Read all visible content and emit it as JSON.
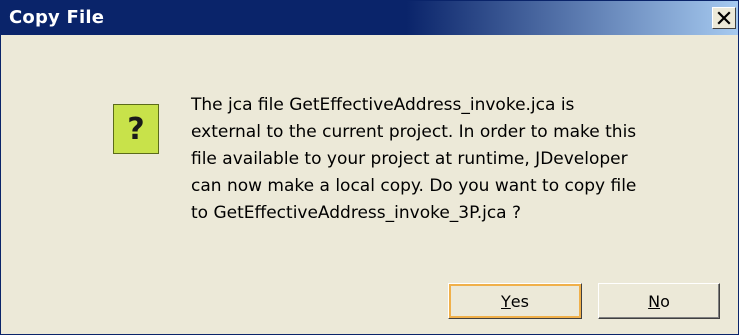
{
  "window": {
    "title": "Copy File",
    "close_icon": "close-icon"
  },
  "icon": {
    "name": "question-icon",
    "glyph": "?",
    "color": "#c8e24a"
  },
  "message": {
    "lines": [
      "The jca file GetEffectiveAddress_invoke.jca is",
      "external to the current project. In order to make this",
      "file available to your project at runtime, JDeveloper",
      "can now make a local copy. Do you want to copy file",
      "to GetEffectiveAddress_invoke_3P.jca ?"
    ]
  },
  "buttons": {
    "yes": {
      "mnemonic": "Y",
      "rest": "es"
    },
    "no": {
      "mnemonic": "N",
      "rest": "o"
    }
  }
}
